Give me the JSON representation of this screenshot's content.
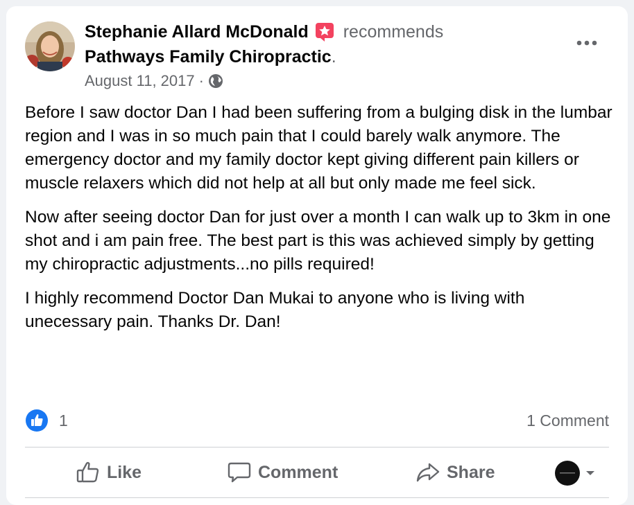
{
  "post": {
    "author": "Stephanie Allard McDonald",
    "action_text": "recommends",
    "page_name": "Pathways Family Chiropractic",
    "page_suffix": ".",
    "date": "August 11, 2017",
    "separator": "·",
    "privacy_icon": "globe-icon",
    "paragraphs": [
      "Before I saw doctor Dan I had been suffering from a bulging disk in the lumbar region and I was in so much pain that I could barely walk anymore. The emergency doctor and my family doctor kept giving different pain killers or muscle relaxers which did not help at all but only made me feel sick.",
      "Now after seeing doctor Dan for just over a month I can walk up to 3km in one shot and i am pain free. The best part is this was achieved simply by getting my chiropractic adjustments...no pills required!",
      "I highly recommend Doctor Dan Mukai to anyone who is living with unecessary pain. Thanks Dr. Dan!"
    ]
  },
  "stats": {
    "like_count": "1",
    "comment_count": "1 Comment"
  },
  "actions": {
    "like_label": "Like",
    "comment_label": "Comment",
    "share_label": "Share"
  },
  "colors": {
    "accent": "#1877f2",
    "recommend": "#f3425f",
    "secondary_text": "#65676b",
    "primary_text": "#050505"
  }
}
